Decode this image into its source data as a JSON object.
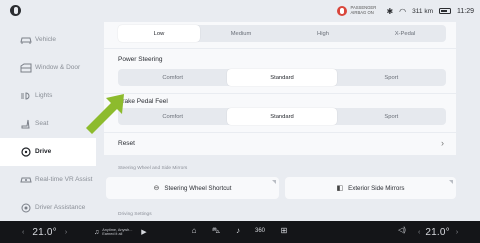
{
  "status": {
    "airbag_text": "PASSENGER AIRBAG ON",
    "range": "311 km",
    "time": "11:29"
  },
  "sidebar": {
    "items": [
      {
        "label": "Vehicle",
        "icon": "car-icon",
        "active": false
      },
      {
        "label": "Window & Door",
        "icon": "window-icon",
        "active": false
      },
      {
        "label": "Lights",
        "icon": "light-icon",
        "active": false
      },
      {
        "label": "Seat",
        "icon": "seat-icon",
        "active": false
      },
      {
        "label": "Drive",
        "icon": "steering-icon",
        "active": true
      },
      {
        "label": "Real-time VR Assist",
        "icon": "vr-assist-icon",
        "active": false
      },
      {
        "label": "Driver Assistance",
        "icon": "driver-assist-icon",
        "active": false
      }
    ]
  },
  "main": {
    "regen": {
      "options": [
        "Low",
        "Medium",
        "High",
        "X-Pedal"
      ],
      "selected": "Low"
    },
    "power_steering": {
      "title": "Power Steering",
      "options": [
        "Comfort",
        "Standard",
        "Sport"
      ],
      "selected": "Standard"
    },
    "brake_pedal": {
      "title": "Brake Pedal Feel",
      "options": [
        "Comfort",
        "Standard",
        "Sport"
      ],
      "selected": "Standard"
    },
    "reset_label": "Reset",
    "group_mirrors": "Steering Wheel and Side Mirrors",
    "steering_shortcut": "Steering Wheel Shortcut",
    "exterior_mirrors": "Exterior Side Mirrors",
    "group_driving": "Driving Settings"
  },
  "bottom": {
    "temp_left": "21.0°",
    "temp_right": "21.0°",
    "media_text": "Anytime, Anywh... Earned it all",
    "colors": {
      "bar": "#141518",
      "accent_arrow": "#8dbb2d"
    }
  }
}
